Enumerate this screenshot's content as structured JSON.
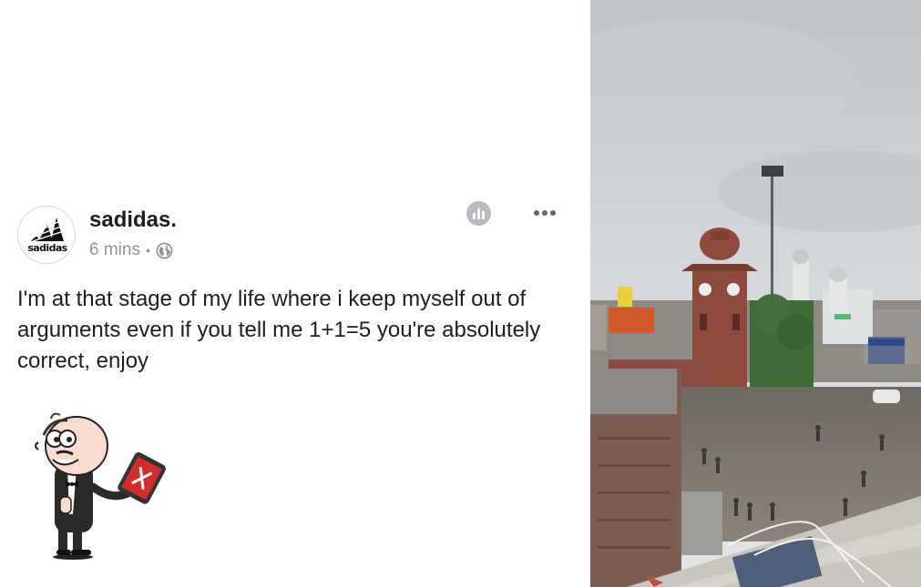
{
  "post": {
    "username": "sadidas.",
    "avatar_text": "sadidas",
    "time": "6 mins",
    "separator": "•",
    "privacy_icon": "globe-icon",
    "stats_icon": "bar-chart-icon",
    "more_icon": "more-horizontal-icon",
    "text": "I'm at that stage of my life where i keep myself out of arguments even if you tell me 1+1=5 you're absolutely correct, enjoy"
  },
  "mascot": {
    "icon": "waiter-with-tablet-icon"
  },
  "photo": {
    "description_icon": "street-photo-clock-tower"
  },
  "colors": {
    "username": "#1c1e21",
    "meta": "#8d949e",
    "sky": "#cfd3d8",
    "brick": "#8e4a3b"
  }
}
